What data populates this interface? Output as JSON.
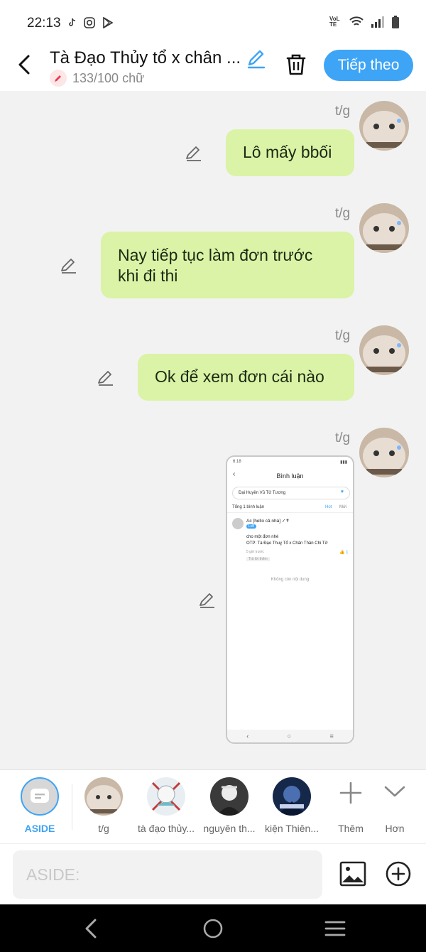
{
  "status": {
    "time": "22:13",
    "network_label": "VoLTE"
  },
  "header": {
    "title": "Tà Đạo Thủy tổ x chân ...",
    "char_count": "133/100 chữ",
    "next_label": "Tiếp theo"
  },
  "messages": [
    {
      "sender": "t/g",
      "text": "Lô mấy bbối"
    },
    {
      "sender": "t/g",
      "text_line1": "Nay tiếp tục làm đơn trước",
      "text_line2": "khi đi thi"
    },
    {
      "sender": "t/g",
      "text": "Ok để xem đơn cái nào"
    },
    {
      "sender": "t/g",
      "type": "image"
    }
  ],
  "shot": {
    "status_time": "6:18",
    "title": "Bình luận",
    "search": "Đại Huyền Vũ Tử Tương",
    "total": "Tổng 1 bình luận",
    "sort_hot": "Hot",
    "sort_new": "Mới",
    "user": "Ac [hello cả nhà] ✓✝",
    "badge": "Lv8",
    "comment_line1": "cho một đơn nhé",
    "comment_line2": "OTP: Tà Đạo Thuỵ Tổ x Chân Thân Chi Tử",
    "time": "5 giờ trước",
    "reply": "Trả lời thêm",
    "likes": "1",
    "empty": "Không còn nội dung"
  },
  "recipients": [
    {
      "label": "ASIDE",
      "active": true
    },
    {
      "label": "t/g"
    },
    {
      "label": "tà đạo thủy..."
    },
    {
      "label": "nguyên th..."
    },
    {
      "label": "kiện Thiên..."
    },
    {
      "label": "Thêm"
    },
    {
      "label": "Hơn"
    }
  ],
  "composer": {
    "placeholder": "ASIDE:"
  },
  "colors": {
    "accent": "#3ea4f5",
    "bubble": "#dbf3a6",
    "background": "#f2f2f2"
  }
}
